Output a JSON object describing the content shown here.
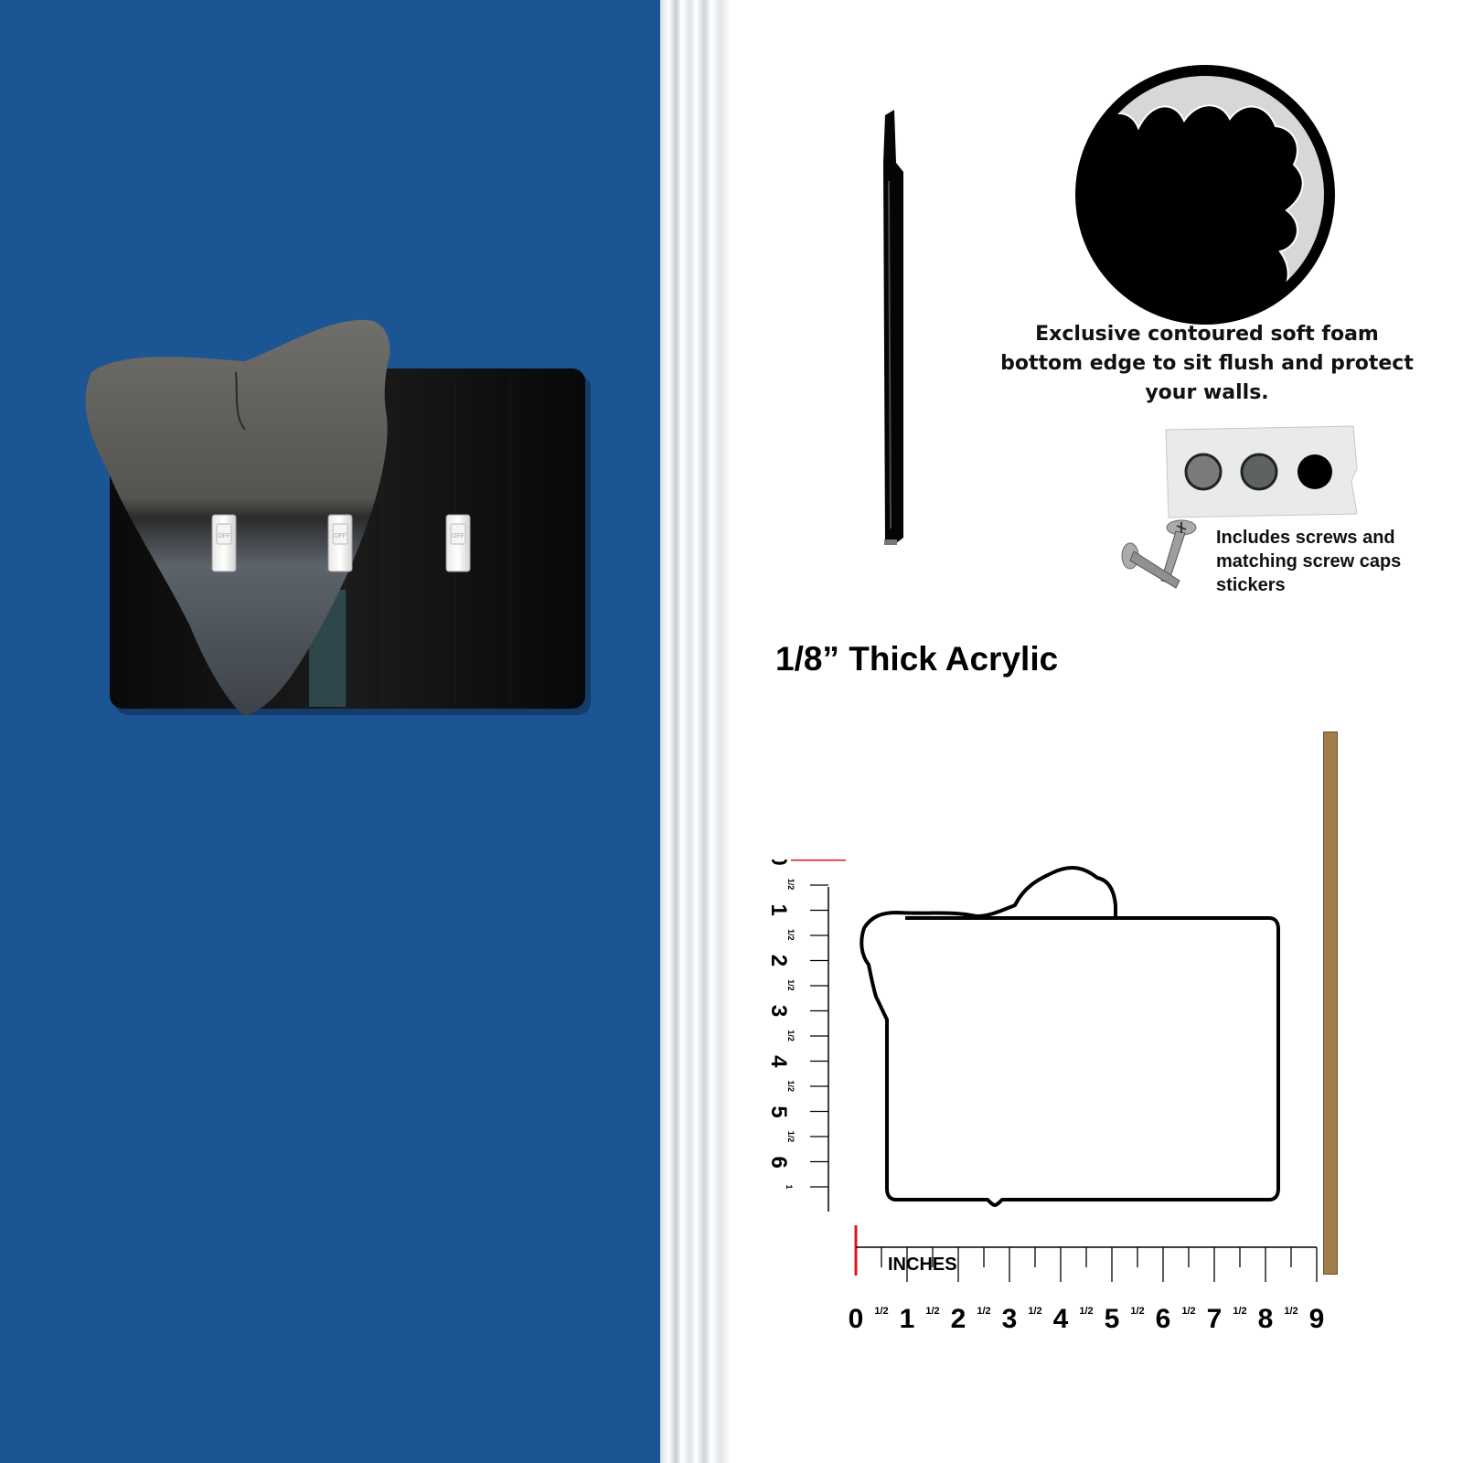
{
  "switch_plate": {
    "switch_label": "OFF",
    "switch_count": 3
  },
  "foam_caption": {
    "line1": "Exclusive contoured soft foam",
    "line2": "bottom edge to sit flush and protect",
    "line3": "your walls."
  },
  "screws_caption": {
    "line1": "Includes screws and",
    "line2": "matching screw caps",
    "line3": "stickers"
  },
  "thickness_title": "1/8” Thick Acrylic",
  "ruler": {
    "unit_label": "INCHES",
    "horizontal_numbers": [
      "0",
      "1",
      "2",
      "3",
      "4",
      "5",
      "6",
      "7",
      "8",
      "9"
    ],
    "vertical_numbers": [
      "0",
      "1",
      "2",
      "3",
      "4",
      "5",
      "6"
    ],
    "vertical_end_digit": "1",
    "half_label": "1/2"
  },
  "colors": {
    "wall": "#1c5594",
    "plate": "#0c0c0c",
    "ruler_zero_mark": "#e0141e",
    "wood_strip": "#a37c4c"
  }
}
